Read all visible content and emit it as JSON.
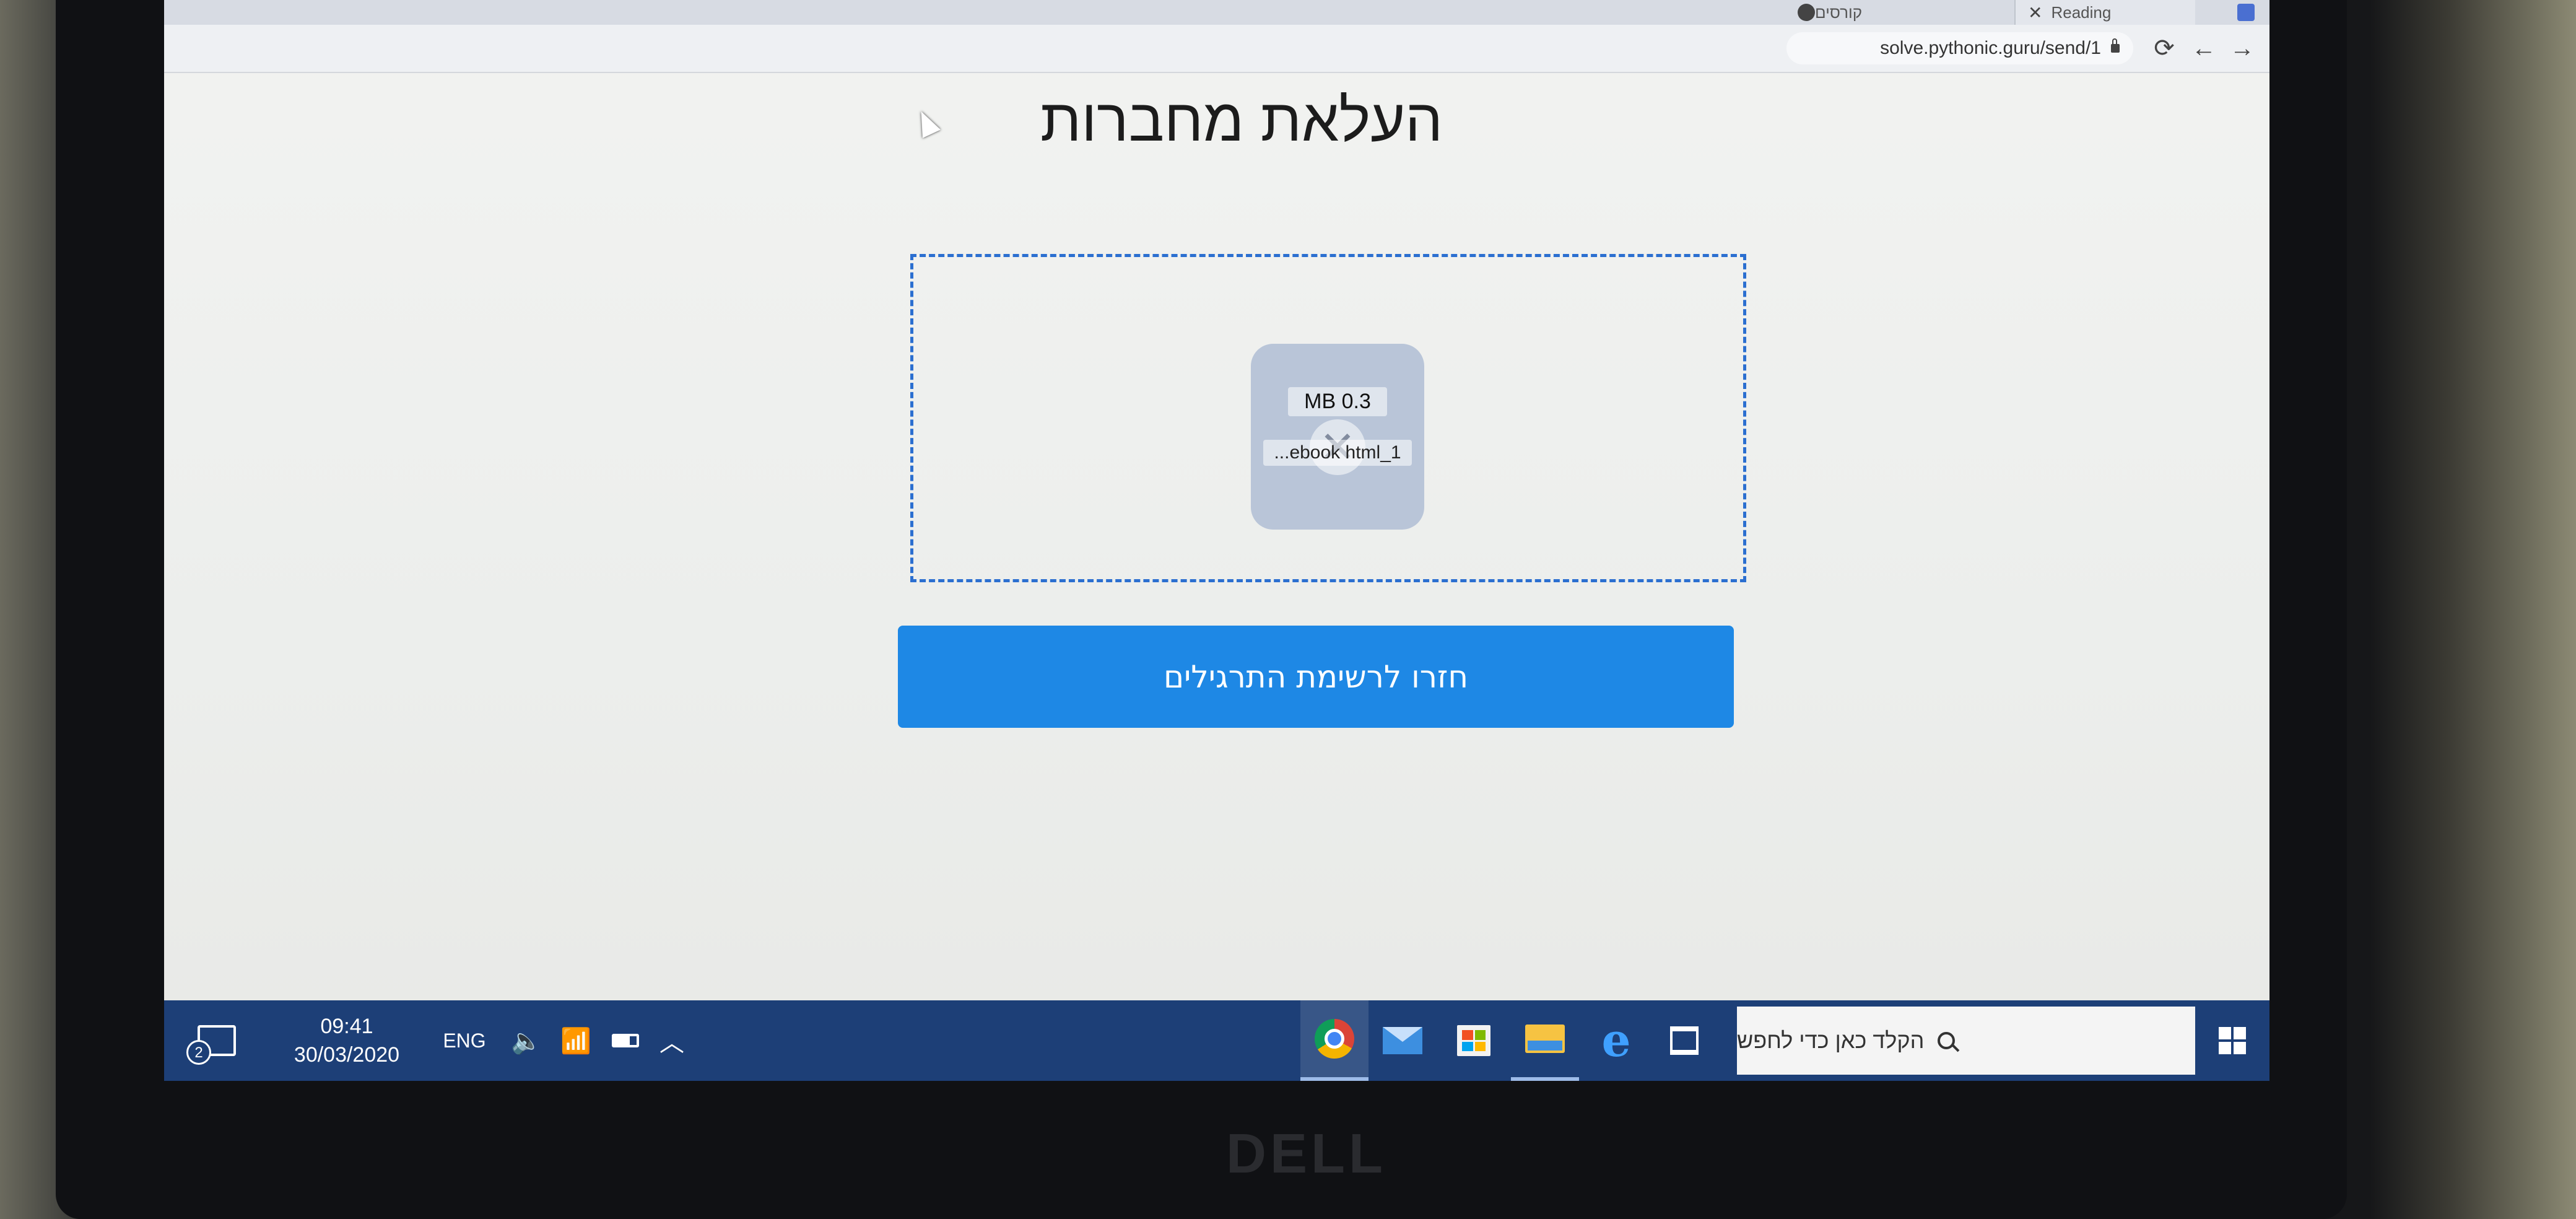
{
  "browser": {
    "tab_reading": "Reading",
    "tab_courses": "קורסים",
    "url": "solve.pythonic.guru/send/1"
  },
  "page": {
    "title": "העלאת מחברות",
    "file_size": "MB 0.3",
    "file_name": "...ebook html_1",
    "back_button_label": "חזרו לרשימת התרגילים",
    "accent_color": "#1e88e5"
  },
  "taskbar": {
    "notification_count": "2",
    "time": "09:41",
    "date": "30/03/2020",
    "language": "ENG",
    "search_placeholder": "הקלד כאן כדי לחפש",
    "apps": [
      "chrome-icon",
      "mail-icon",
      "store-icon",
      "file-explorer-icon",
      "edge-icon",
      "task-view-icon"
    ]
  },
  "device": {
    "brand": "DELL"
  }
}
